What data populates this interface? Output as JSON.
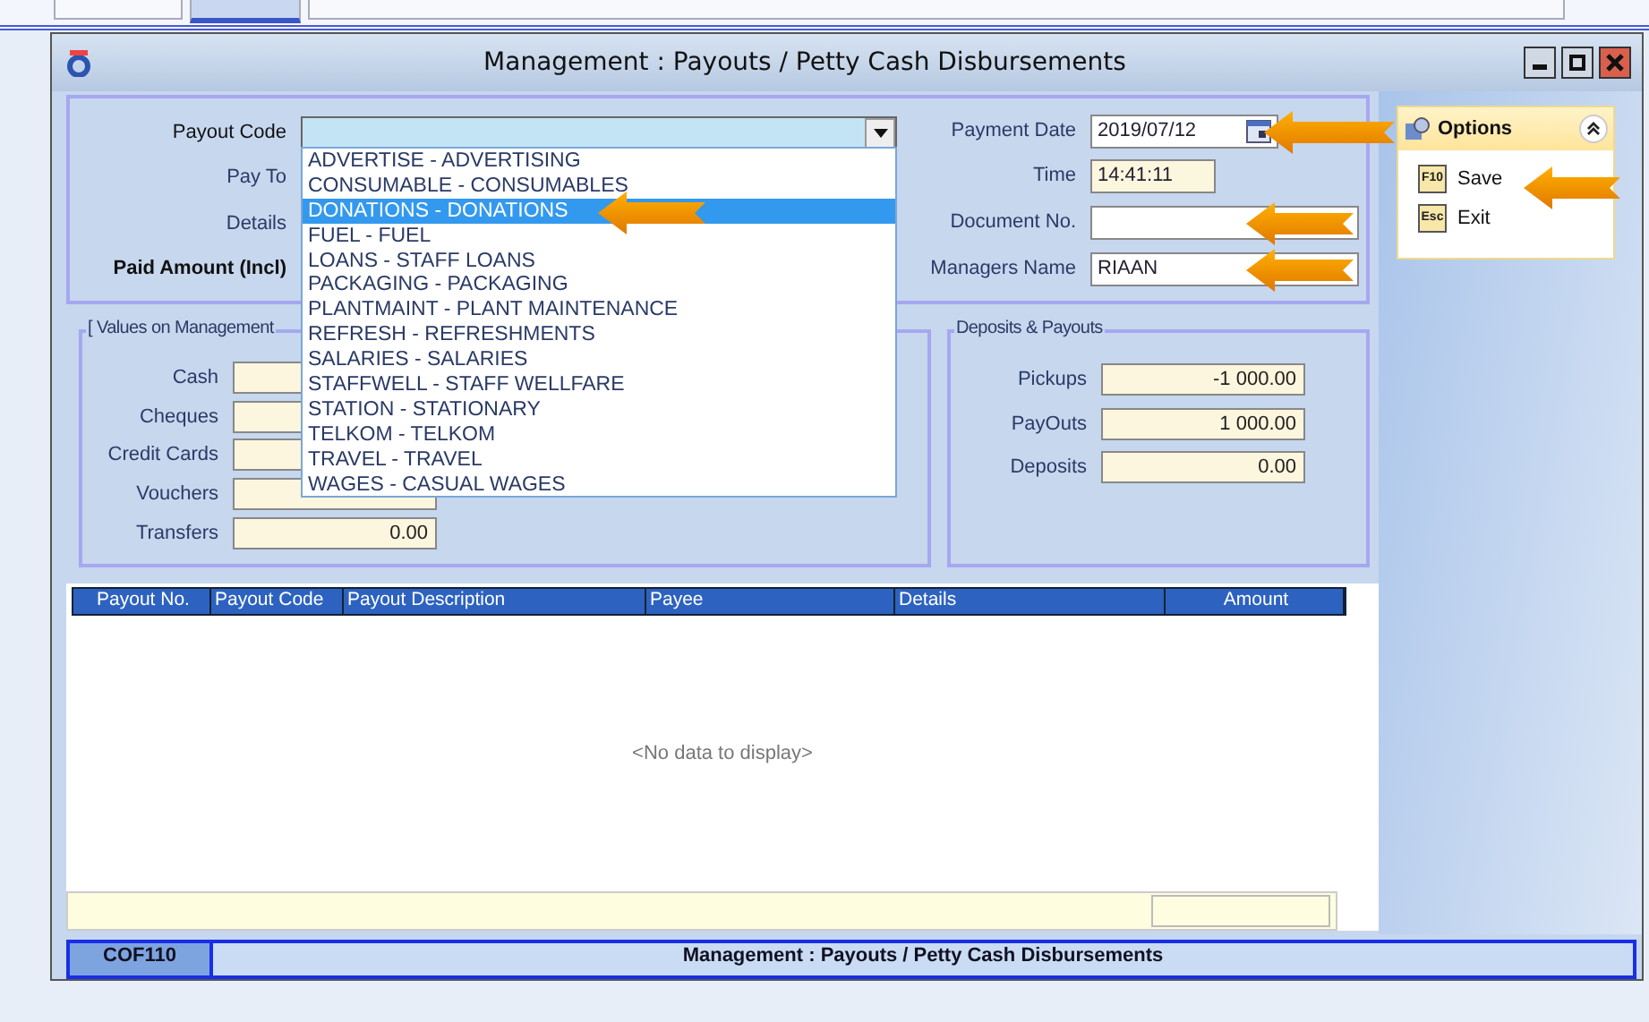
{
  "top_tabs": [
    {
      "selected": false
    },
    {
      "selected": true
    },
    {
      "selected": false
    }
  ],
  "window": {
    "title": "Management : Payouts / Petty Cash Disbursements",
    "controls": [
      {
        "kind": "minimize"
      },
      {
        "kind": "maximize"
      },
      {
        "kind": "close"
      }
    ]
  },
  "header_form": {
    "payout_code": {
      "label": "Payout Code",
      "expanded": true
    },
    "left_labels": [
      {
        "label": "Pay To",
        "bold": false
      },
      {
        "label": "Details",
        "bold": false
      },
      {
        "label": "Paid Amount (Incl)",
        "bold": true
      }
    ],
    "right_fields": [
      {
        "kind": "date",
        "label": "Payment Date",
        "value": "2019/07/12"
      },
      {
        "kind": "readonly",
        "label": "Time",
        "value": "14:41:11"
      },
      {
        "kind": "text",
        "label": "Document No."
      },
      {
        "kind": "text",
        "label": "Managers Name",
        "value": "RIAAN"
      }
    ]
  },
  "dropdown_items": [
    {
      "label": "ADVERTISE - ADVERTISING",
      "selected": false
    },
    {
      "label": "CONSUMABLE - CONSUMABLES",
      "selected": false
    },
    {
      "label": "DONATIONS - DONATIONS",
      "selected": true
    },
    {
      "label": "FUEL - FUEL",
      "selected": false
    },
    {
      "label": "LOANS - STAFF LOANS",
      "selected": false
    },
    {
      "label": "PACKAGING - PACKAGING",
      "selected": false
    },
    {
      "label": "PLANTMAINT - PLANT MAINTENANCE",
      "selected": false
    },
    {
      "label": "REFRESH - REFRESHMENTS",
      "selected": false
    },
    {
      "label": "SALARIES - SALARIES",
      "selected": false
    },
    {
      "label": "STAFFWELL - STAFF WELLFARE",
      "selected": false
    },
    {
      "label": "STATION - STATIONARY",
      "selected": false
    },
    {
      "label": "TELKOM - TELKOM",
      "selected": false
    },
    {
      "label": "TRAVEL - TRAVEL",
      "selected": false
    },
    {
      "label": "WAGES - CASUAL WAGES",
      "selected": false
    }
  ],
  "values_group": {
    "title": "[ Values on Management",
    "rows": [
      {
        "label": "Cash"
      },
      {
        "label": "Cheques"
      },
      {
        "label": "Credit Cards"
      },
      {
        "label": "Vouchers"
      },
      {
        "label": "Transfers",
        "value": "0.00"
      }
    ]
  },
  "deposits_group": {
    "title": "Deposits & Payouts",
    "rows": [
      {
        "label": "Pickups",
        "value": "-1 000.00"
      },
      {
        "label": "PayOuts",
        "value": "1 000.00"
      },
      {
        "label": "Deposits",
        "value": "0.00"
      }
    ]
  },
  "options": {
    "title": "Options",
    "expanded": true,
    "items": [
      {
        "key": "F10",
        "label": "Save"
      },
      {
        "key": "Esc",
        "label": "Exit"
      }
    ]
  },
  "grid": {
    "columns": [
      "Payout No.",
      "Payout Code",
      "Payout Description",
      "Payee",
      "Details",
      "Amount"
    ],
    "empty_text": "<No data to display>"
  },
  "status_bar": {
    "code": "COF110",
    "title": "Management : Payouts / Petty Cash Disbursements"
  }
}
